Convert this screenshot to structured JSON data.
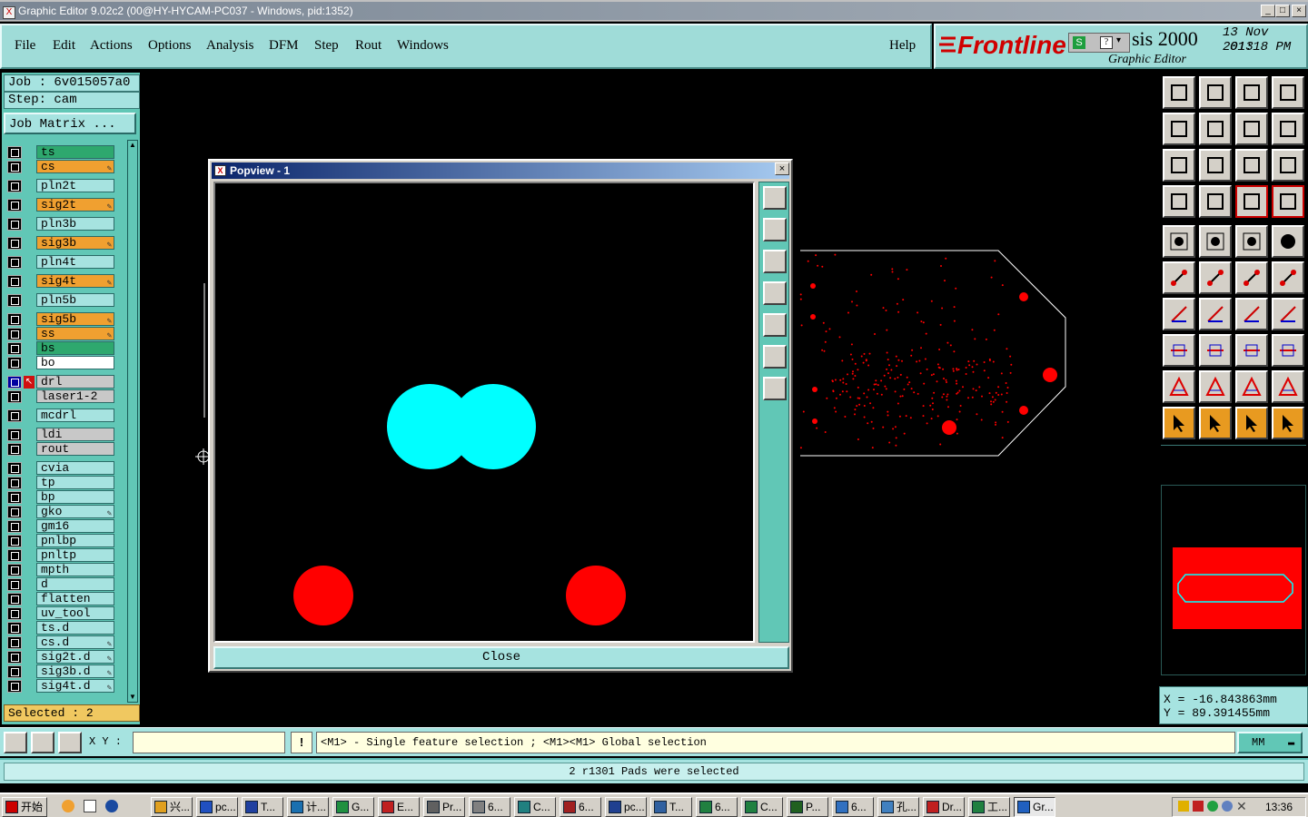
{
  "window": {
    "title": "Graphic Editor 9.02c2 (00@HY-HYCAM-PC037 - Windows, pid:1352)",
    "min": "_",
    "max": "□",
    "close": "×"
  },
  "menu": {
    "items": [
      "File",
      "Edit",
      "Actions",
      "Options",
      "Analysis",
      "DFM",
      "Step",
      "Rout",
      "Windows"
    ],
    "help": "Help"
  },
  "logo": {
    "brand": "Frontline",
    "product": "sis 2000",
    "subtitle": "Graphic Editor",
    "date": "13 Nov 2013",
    "time": "01:18 PM",
    "brand_color": "#d00000"
  },
  "job": {
    "job_line": "Job : 6v015057a0",
    "step_line": "Step: cam",
    "matrix_button": "Job Matrix ..."
  },
  "layers": [
    {
      "name": "ts",
      "color": "#2ea86e",
      "edit": false
    },
    {
      "name": "cs",
      "color": "#f0a030",
      "edit": true
    },
    {
      "name": "pln2t",
      "color": "#a6e3e0",
      "edit": false
    },
    {
      "name": "sig2t",
      "color": "#f0a030",
      "edit": true
    },
    {
      "name": "pln3b",
      "color": "#a6e3e0",
      "edit": false
    },
    {
      "name": "sig3b",
      "color": "#f0a030",
      "edit": true
    },
    {
      "name": "pln4t",
      "color": "#a6e3e0",
      "edit": false
    },
    {
      "name": "sig4t",
      "color": "#f0a030",
      "edit": true
    },
    {
      "name": "pln5b",
      "color": "#a6e3e0",
      "edit": false
    },
    {
      "name": "sig5b",
      "color": "#f0a030",
      "edit": true
    },
    {
      "name": "ss",
      "color": "#f0a030",
      "edit": true
    },
    {
      "name": "bs",
      "color": "#2ea86e",
      "edit": false
    },
    {
      "name": "bo",
      "color": "#ffffff",
      "edit": false
    },
    {
      "name": "drl",
      "color": "#c8c8c8",
      "edit": false,
      "active": true
    },
    {
      "name": "laser1-2",
      "color": "#c8c8c8",
      "edit": false
    },
    {
      "name": "mcdrl",
      "color": "#a6e3e0",
      "edit": false
    },
    {
      "name": "ldi",
      "color": "#c8c8c8",
      "edit": false
    },
    {
      "name": "rout",
      "color": "#c8c8c8",
      "edit": false
    },
    {
      "name": "cvia",
      "color": "#a6e3e0",
      "edit": false
    },
    {
      "name": "tp",
      "color": "#a6e3e0",
      "edit": false
    },
    {
      "name": "bp",
      "color": "#a6e3e0",
      "edit": false
    },
    {
      "name": "gko",
      "color": "#a6e3e0",
      "edit": true
    },
    {
      "name": "gm16",
      "color": "#a6e3e0",
      "edit": false
    },
    {
      "name": "pnlbp",
      "color": "#a6e3e0",
      "edit": false
    },
    {
      "name": "pnltp",
      "color": "#a6e3e0",
      "edit": false
    },
    {
      "name": "mpth",
      "color": "#a6e3e0",
      "edit": false
    },
    {
      "name": "d",
      "color": "#a6e3e0",
      "edit": false
    },
    {
      "name": "flatten",
      "color": "#a6e3e0",
      "edit": false
    },
    {
      "name": "uv_tool",
      "color": "#a6e3e0",
      "edit": false
    },
    {
      "name": "ts.d",
      "color": "#a6e3e0",
      "edit": false
    },
    {
      "name": "cs.d",
      "color": "#a6e3e0",
      "edit": true
    },
    {
      "name": "sig2t.d",
      "color": "#a6e3e0",
      "edit": true
    },
    {
      "name": "sig3b.d",
      "color": "#a6e3e0",
      "edit": true
    },
    {
      "name": "sig4t.d",
      "color": "#a6e3e0",
      "edit": true
    }
  ],
  "selected": "Selected : 2",
  "popview": {
    "title": "Popview - 1",
    "close_label": "Close"
  },
  "coords": {
    "x": "X = -16.843863mm",
    "y": "Y = 89.391455mm"
  },
  "bottom": {
    "xy_label": "X Y :",
    "xy_value": "",
    "hint": "<M1> - Single feature selection ; <M1><M1> Global selection",
    "units": "MM"
  },
  "status": "2 r1301 Pads were selected",
  "taskbar": {
    "start": "开始",
    "tasks": [
      "兴...",
      "pc...",
      "T...",
      "计...",
      "G...",
      "E...",
      "Pr...",
      "6...",
      "C...",
      "6...",
      "pc...",
      "T...",
      "6...",
      "C...",
      "P...",
      "6...",
      "孔...",
      "Dr...",
      "工...",
      "Gr..."
    ],
    "clock": "13:36"
  }
}
